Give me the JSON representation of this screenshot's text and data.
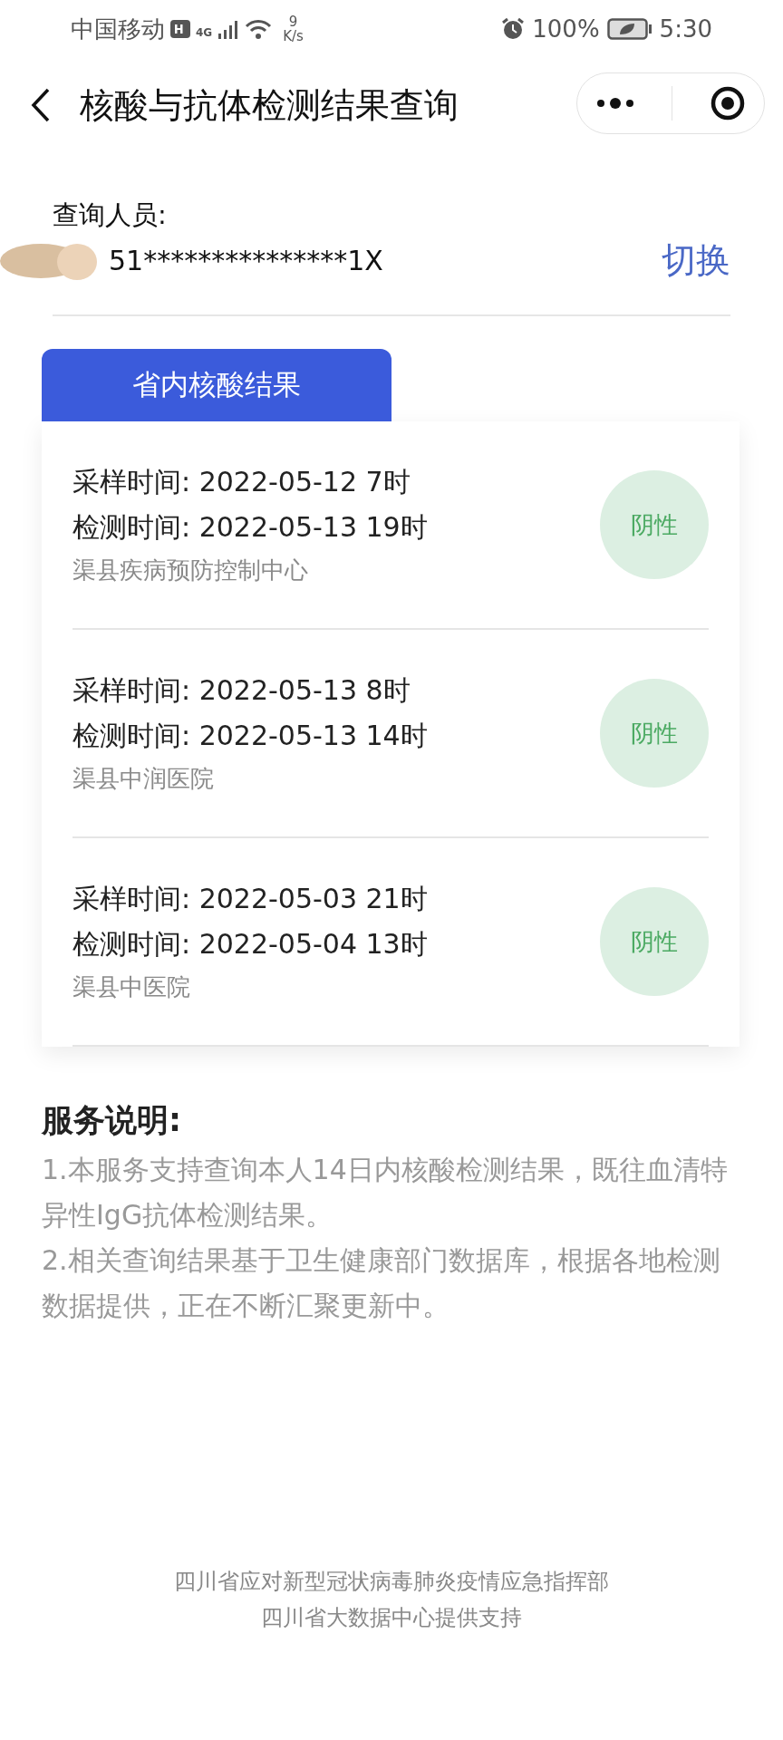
{
  "status_bar": {
    "carrier": "中国移动",
    "network": "4G",
    "speed_value": "9",
    "speed_unit": "K/s",
    "battery": "100%",
    "time": "5:30"
  },
  "nav": {
    "title": "核酸与抗体检测结果查询"
  },
  "person": {
    "label": "查询人员:",
    "id_number": "51***************1X",
    "switch_label": "切换"
  },
  "tabs": [
    {
      "label": "省内核酸结果",
      "selected": true
    }
  ],
  "results": [
    {
      "sample_label": "采样时间:",
      "sample_time": "2022-05-12 7时",
      "test_label": "检测时间:",
      "test_time": "2022-05-13 19时",
      "institution": "渠县疾病预防控制中心",
      "result": "阴性"
    },
    {
      "sample_label": "采样时间:",
      "sample_time": "2022-05-13 8时",
      "test_label": "检测时间:",
      "test_time": "2022-05-13 14时",
      "institution": "渠县中润医院",
      "result": "阴性"
    },
    {
      "sample_label": "采样时间:",
      "sample_time": "2022-05-03 21时",
      "test_label": "检测时间:",
      "test_time": "2022-05-04 13时",
      "institution": "渠县中医院",
      "result": "阴性"
    }
  ],
  "service_notes": {
    "title": "服务说明:",
    "items": [
      "1.本服务支持查询本人14日内核酸检测结果，既往血清特异性IgG抗体检测结果。",
      "2.相关查询结果基于卫生健康部门数据库，根据各地检测数据提供，正在不断汇聚更新中。"
    ]
  },
  "footer": [
    "四川省应对新型冠状病毒肺炎疫情应急指挥部",
    "四川省大数据中心提供支持"
  ]
}
